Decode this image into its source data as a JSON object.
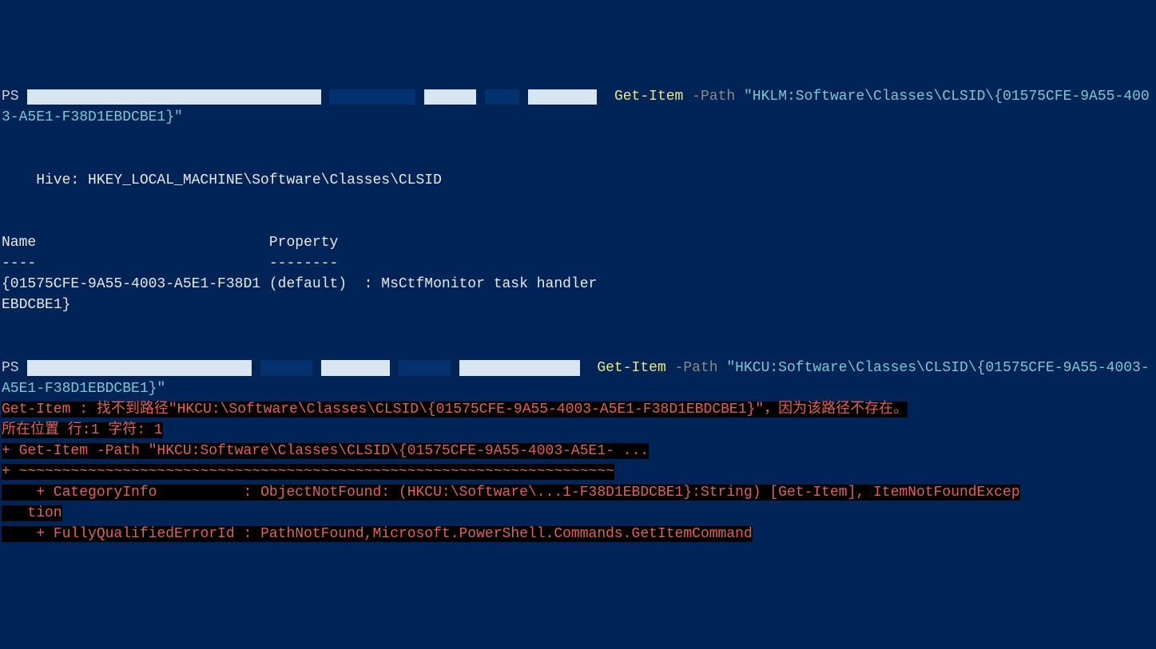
{
  "prompt1": {
    "ps": "PS ",
    "cmdlet": "Get-Item",
    "param": " -Path ",
    "arg": "\"HKLM:Software\\Classes\\CLSID\\{01575CFE-9A55-4003-A5E1-F38D1EBDCBE1}\""
  },
  "output1": {
    "hive": "Hive: HKEY_LOCAL_MACHINE\\Software\\Classes\\CLSID",
    "header_name": "Name",
    "header_prop": "Property",
    "dash_name": "----",
    "dash_prop": "--------",
    "row1": "{01575CFE-9A55-4003-A5E1-F38D1 (default)  : MsCtfMonitor task handler",
    "row2": "EBDCBE1}"
  },
  "prompt2": {
    "ps": "PS ",
    "cmdlet": "Get-Item",
    "param": " -Path ",
    "arg": "\"HKCU:Software\\Classes\\CLSID\\{01575CFE-9A55-4003-A5E1-F38D1EBDCBE1}\""
  },
  "error": {
    "line1": "Get-Item : 找不到路径\"HKCU:\\Software\\Classes\\CLSID\\{01575CFE-9A55-4003-A5E1-F38D1EBDCBE1}\"，因为该路径不存在。",
    "line2": "所在位置 行:1 字符: 1",
    "line3": "+ Get-Item -Path \"HKCU:Software\\Classes\\CLSID\\{01575CFE-9A55-4003-A5E1- ...",
    "line4": "+ ~~~~~~~~~~~~~~~~~~~~~~~~~~~~~~~~~~~~~~~~~~~~~~~~~~~~~~~~~~~~~~~~~~~~~",
    "line5": "    + CategoryInfo          : ObjectNotFound: (HKCU:\\Software\\...1-F38D1EBDCBE1}:String) [Get-Item], ItemNotFoundExcep",
    "line5b": "   tion",
    "line6": "    + FullyQualifiedErrorId : PathNotFound,Microsoft.PowerShell.Commands.GetItemCommand"
  }
}
